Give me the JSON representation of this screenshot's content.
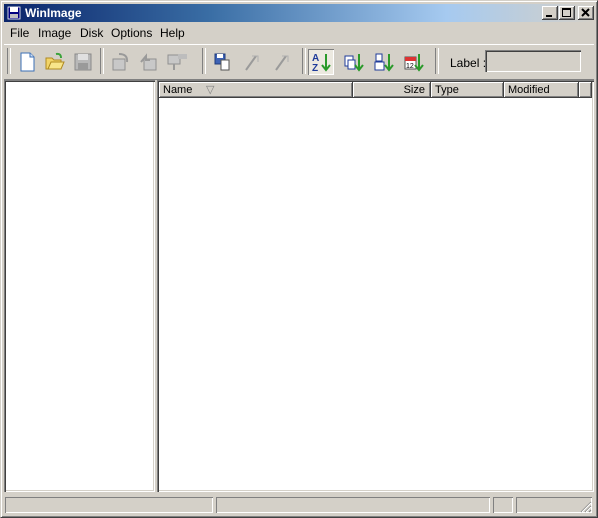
{
  "window": {
    "title": "WinImage",
    "minimize": "_",
    "maximize": "□",
    "close": "✕"
  },
  "menu": [
    {
      "label": "File"
    },
    {
      "label": "Image"
    },
    {
      "label": "Disk"
    },
    {
      "label": "Options"
    },
    {
      "label": "Help"
    }
  ],
  "toolbar": {
    "buttons": [
      {
        "icon": "new-document-icon",
        "enabled": true
      },
      {
        "icon": "open-folder-icon",
        "enabled": true
      },
      {
        "icon": "save-disk-icon",
        "enabled": false
      },
      {
        "icon": "read-disk-icon",
        "enabled": false
      },
      {
        "icon": "write-disk-icon",
        "enabled": false
      },
      {
        "icon": "format-write-icon",
        "enabled": false
      },
      {
        "icon": "inject-file-icon",
        "enabled": true
      },
      {
        "icon": "extract-icon",
        "enabled": false
      },
      {
        "icon": "extract-path-icon",
        "enabled": false
      },
      {
        "icon": "sort-by-name-icon",
        "enabled": true,
        "active": true
      },
      {
        "icon": "sort-by-type-icon",
        "enabled": true
      },
      {
        "icon": "sort-by-size-icon",
        "enabled": true
      },
      {
        "icon": "sort-by-date-icon",
        "enabled": true
      }
    ],
    "label_caption": "Label :",
    "label_value": ""
  },
  "file_list": {
    "columns": [
      {
        "label": "Name",
        "sort_indicator": "▽"
      },
      {
        "label": "Size"
      },
      {
        "label": "Type"
      },
      {
        "label": "Modified"
      }
    ],
    "rows": []
  },
  "status": {
    "panels": [
      "",
      "",
      "",
      ""
    ]
  }
}
